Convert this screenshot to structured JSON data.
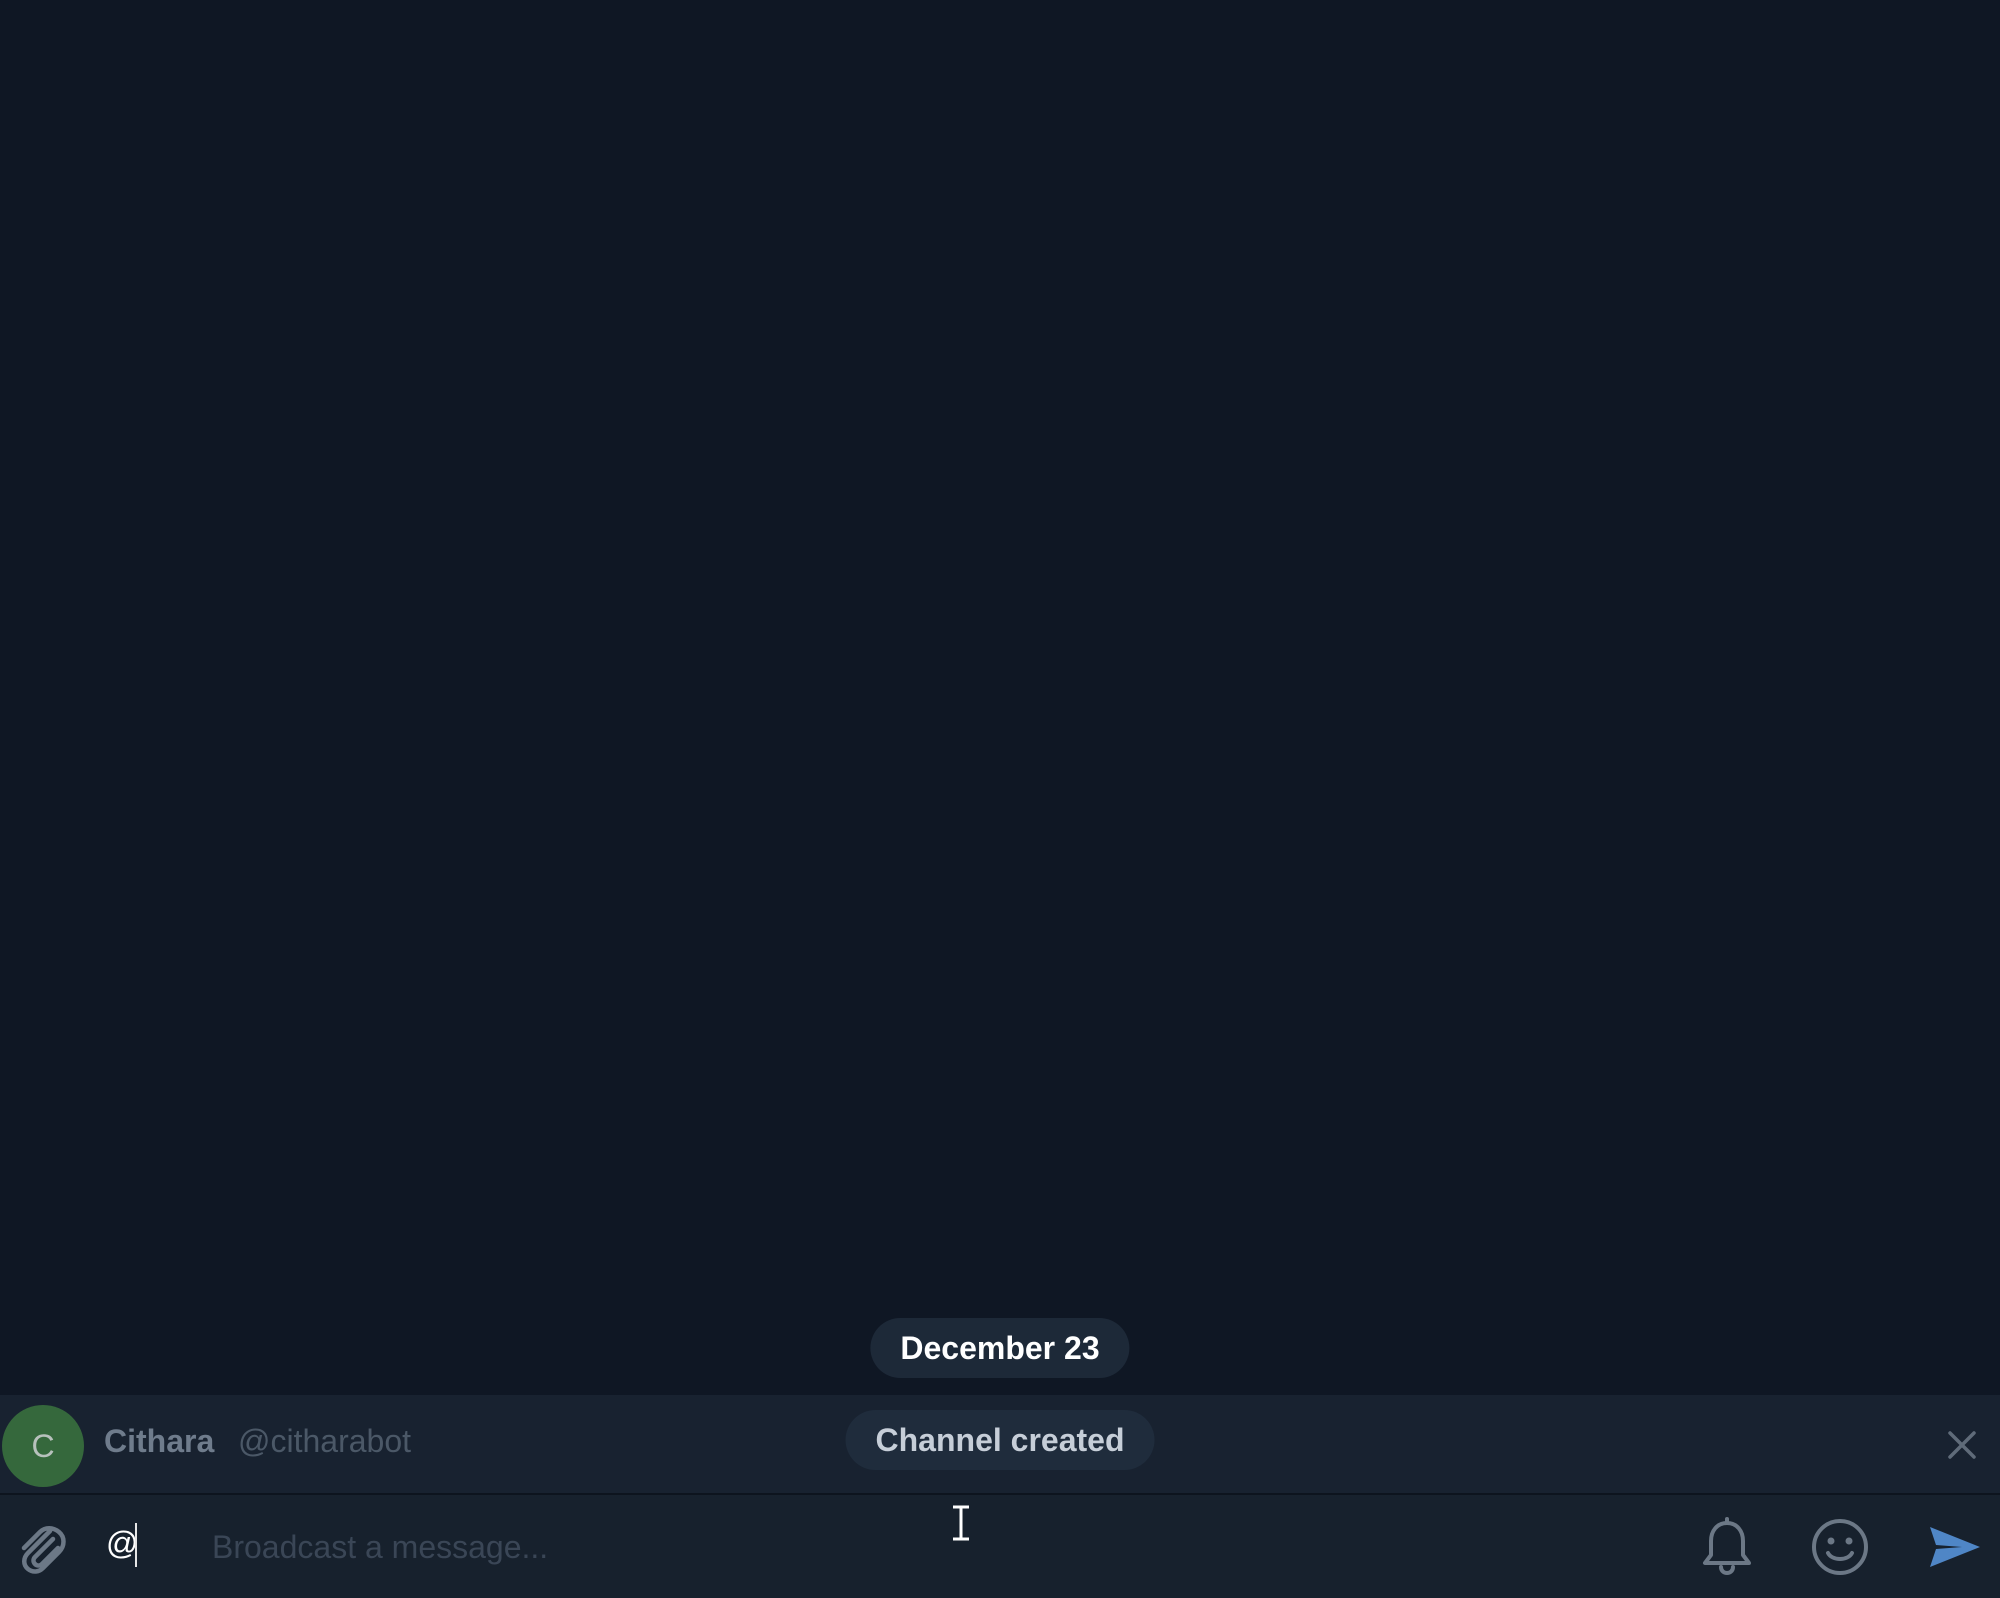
{
  "chat": {
    "date_label": "December 23",
    "service_message": "Channel created"
  },
  "mention_suggestion": {
    "avatar_letter": "C",
    "avatar_color": "#3d7a3f",
    "name": "Cithara",
    "username": "@citharabot"
  },
  "composer": {
    "typed_text": "@",
    "placeholder": "Broadcast a message..."
  },
  "icons": {
    "attach": "paperclip-icon",
    "close": "close-icon",
    "silent": "bell-icon",
    "emoji": "smile-icon",
    "send": "send-icon"
  },
  "colors": {
    "background": "#0f1724",
    "accent": "#5288c1"
  }
}
